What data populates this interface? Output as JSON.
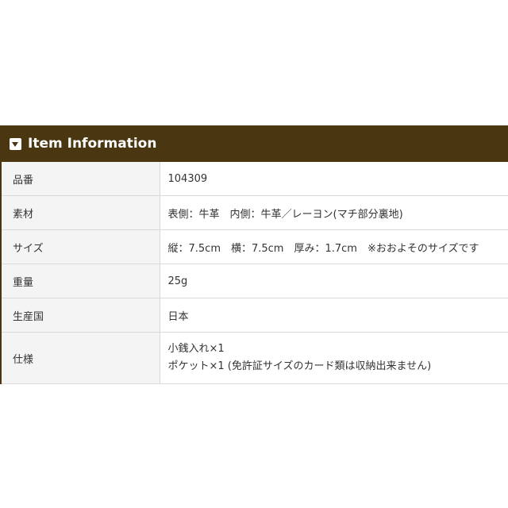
{
  "header": {
    "title": "Item Information",
    "icon": "chevron-down-box-icon"
  },
  "rows": [
    {
      "label": "品番",
      "value": "104309"
    },
    {
      "label": "素材",
      "value": "表側：牛革　内側：牛革／レーヨン(マチ部分裏地)"
    },
    {
      "label": "サイズ",
      "value": "縦：7.5cm　横：7.5cm　厚み：1.7cm　※おおよそのサイズです"
    },
    {
      "label": "重量",
      "value": "25g"
    },
    {
      "label": "生産国",
      "value": "日本"
    },
    {
      "label": "仕様",
      "lines": [
        "小銭入れ×1",
        "ポケット×1 (免許証サイズのカード類は収納出来ません)"
      ]
    }
  ],
  "colors": {
    "header_bg": "#4a3712",
    "label_bg": "#f4f4f4",
    "border": "#d9d9d9"
  }
}
